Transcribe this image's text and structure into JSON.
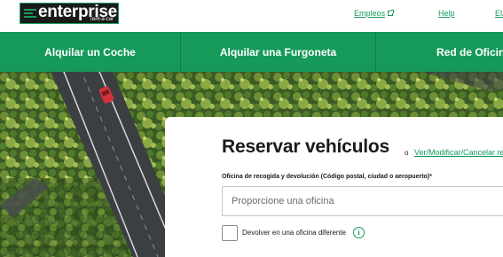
{
  "brand": {
    "logo_text": "enterprise",
    "logo_sub": "rent-a-car"
  },
  "topbar": {
    "links": [
      {
        "label": "Empleos",
        "icon": "external-link-icon"
      },
      {
        "label": "Help"
      },
      {
        "label": "EU"
      }
    ]
  },
  "nav": {
    "items": [
      {
        "label": "Alquilar un Coche"
      },
      {
        "label": "Alquilar una Furgoneta"
      },
      {
        "label": "Red de Oficinas"
      }
    ]
  },
  "booking": {
    "title": "Reservar vehículos",
    "or_text": "o",
    "modify_link": "Ver/Modificar/Cancelar reserva",
    "location_label": "Oficina de recogida y devolución (Código postal, ciudad o aeropuerto)*",
    "location_placeholder": "Proporcione una oficina",
    "location_value": "",
    "return_different_label": "Devolver en una oficina diferente",
    "return_different_checked": false
  },
  "colors": {
    "brand_green": "#169a5a",
    "text_dark": "#1a1a1a"
  }
}
